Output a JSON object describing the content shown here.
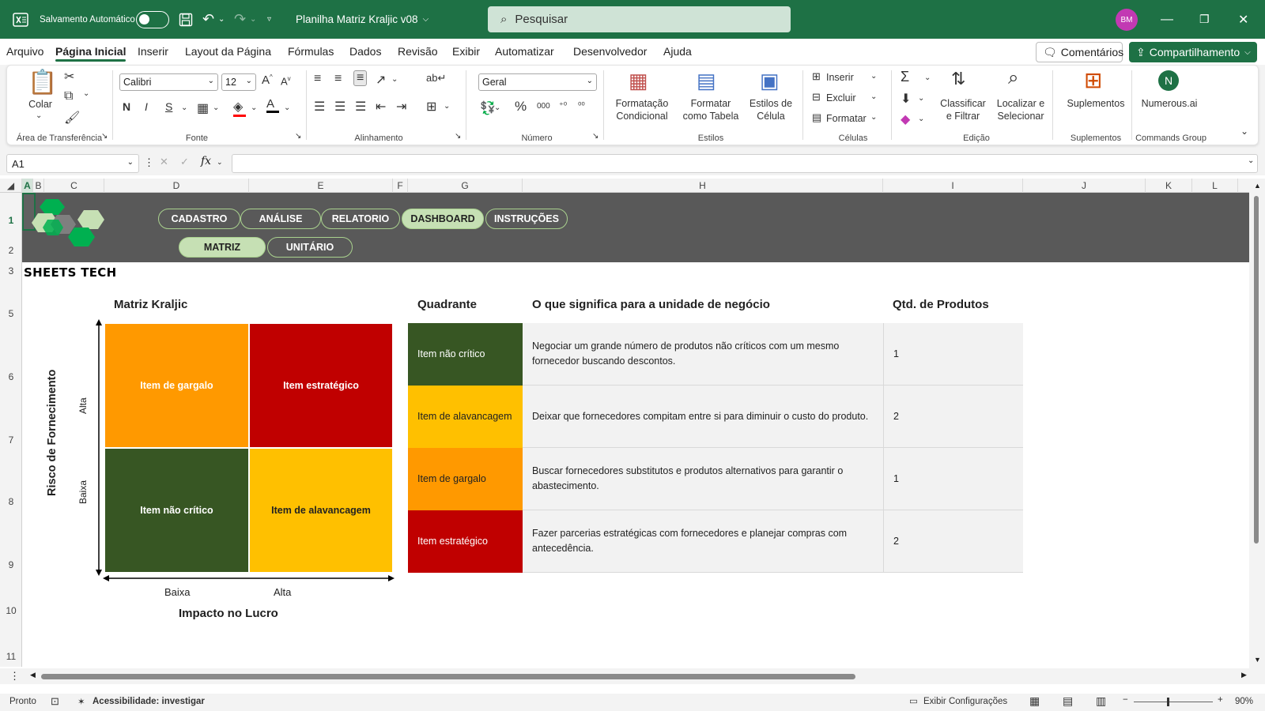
{
  "titlebar": {
    "autosave_label": "Salvamento Automático",
    "filename": "Planilha Matriz Kraljic v08",
    "search_placeholder": "Pesquisar",
    "avatar_initials": "BM"
  },
  "menu": {
    "items": [
      "Arquivo",
      "Página Inicial",
      "Inserir",
      "Layout da Página",
      "Fórmulas",
      "Dados",
      "Revisão",
      "Exibir",
      "Automatizar",
      "Desenvolvedor",
      "Ajuda"
    ],
    "active": "Página Inicial",
    "comments_label": "Comentários",
    "share_label": "Compartilhamento"
  },
  "ribbon": {
    "paste_label": "Colar",
    "clipboard_group": "Área de Transferência",
    "font_name": "Calibri",
    "font_size": "12",
    "font_group": "Fonte",
    "align_group": "Alinhamento",
    "number_format": "Geral",
    "number_group": "Número",
    "cond_format": "Formatação Condicional",
    "format_table": "Formatar como Tabela",
    "cell_styles": "Estilos de Célula",
    "styles_group": "Estilos",
    "insert_label": "Inserir",
    "delete_label": "Excluir",
    "format_label": "Formatar",
    "cells_group": "Células",
    "sort_filter": "Classificar e Filtrar",
    "find_select": "Localizar e Selecionar",
    "editing_group": "Edição",
    "addins_label": "Suplementos",
    "addins_group": "Suplementos",
    "numerous_label": "Numerous.ai",
    "commands_group": "Commands Group"
  },
  "formulabar": {
    "namebox": "A1",
    "fx": "fx"
  },
  "columns": [
    "A",
    "B",
    "C",
    "D",
    "E",
    "F",
    "G",
    "H",
    "I",
    "J",
    "K",
    "L"
  ],
  "rows": [
    "1",
    "2",
    "3",
    "5",
    "6",
    "7",
    "8",
    "9",
    "10",
    "11"
  ],
  "sheet": {
    "brand": "SHEETS TECH",
    "nav_top": [
      "CADASTRO",
      "ANÁLISE",
      "RELATORIO",
      "DASHBOARD",
      "INSTRUÇÕES"
    ],
    "nav_bottom": [
      "MATRIZ",
      "UNITÁRIO"
    ],
    "matrix_title": "Matriz Kraljic",
    "matrix": {
      "top_left": "Item de gargalo",
      "top_right": "Item estratégico",
      "bottom_left": "Item não crítico",
      "bottom_right": "Item de alavancagem",
      "y_axis": "Risco de Fornecimento",
      "y_high": "Alta",
      "y_low": "Baixa",
      "x_axis": "Impacto no Lucro",
      "x_low": "Baixa",
      "x_high": "Alta"
    },
    "table": {
      "headers": [
        "Quadrante",
        "O que significa para a unidade de negócio",
        "Qtd. de Produtos"
      ],
      "rows": [
        {
          "quadrant": "Item não crítico",
          "meaning": "Negociar um grande número de produtos não críticos com um mesmo fornecedor buscando descontos.",
          "qty": "1",
          "color": "#375623"
        },
        {
          "quadrant": "Item de alavancagem",
          "meaning": "Deixar que fornecedores compitam entre si para diminuir o custo do produto.",
          "qty": "2",
          "color": "#ffc000"
        },
        {
          "quadrant": "Item de gargalo",
          "meaning": "Buscar fornecedores substitutos e produtos alternativos para garantir o abastecimento.",
          "qty": "1",
          "color": "#ff9900"
        },
        {
          "quadrant": "Item estratégico",
          "meaning": "Fazer parcerias estratégicas com fornecedores e planejar compras com antecedência.",
          "qty": "2",
          "color": "#c00000"
        }
      ]
    }
  },
  "statusbar": {
    "ready": "Pronto",
    "accessibility": "Acessibilidade: investigar",
    "display_settings": "Exibir Configurações",
    "zoom": "90%"
  },
  "colors": {
    "excel_green": "#1e7145",
    "banner": "#595959",
    "pill_border": "#a9d18e",
    "pill_active": "#c6e0b4",
    "orange": "#ff9900",
    "red": "#c00000",
    "dark_green": "#375623",
    "yellow": "#ffc000"
  }
}
